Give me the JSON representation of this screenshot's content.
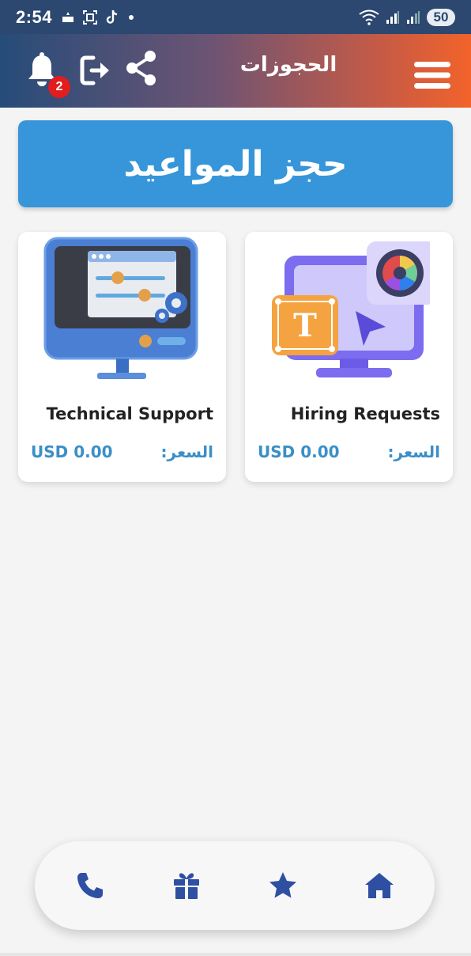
{
  "status_bar": {
    "time": "2:54",
    "battery": "50",
    "icons": [
      "sim-icon",
      "screenshot-icon",
      "tiktok-icon",
      "dot-icon",
      "wifi-icon",
      "signal-icon",
      "signal-icon-2"
    ]
  },
  "header": {
    "title": "الحجوزات",
    "notification_count": "2",
    "icons": [
      "bell-icon",
      "logout-icon",
      "share-icon",
      "menu-icon"
    ]
  },
  "banner": {
    "label": "حجز المواعيد",
    "color": "#3696d9"
  },
  "services": [
    {
      "name": "Technical Support",
      "price_label": "السعر:",
      "price": "USD 0.00",
      "image": "computer-settings-illustration"
    },
    {
      "name": "Hiring Requests",
      "price_label": "السعر:",
      "price": "USD 0.00",
      "image": "design-tools-illustration"
    }
  ],
  "bottom_nav": {
    "items": [
      "phone-icon",
      "gift-icon",
      "star-icon",
      "home-icon"
    ],
    "icon_color": "#2f4fa3"
  },
  "colors": {
    "header_gradient_start": "#264c79",
    "header_gradient_end": "#f2632a",
    "price_color": "#3b8fc6",
    "badge": "#e11d1d"
  }
}
